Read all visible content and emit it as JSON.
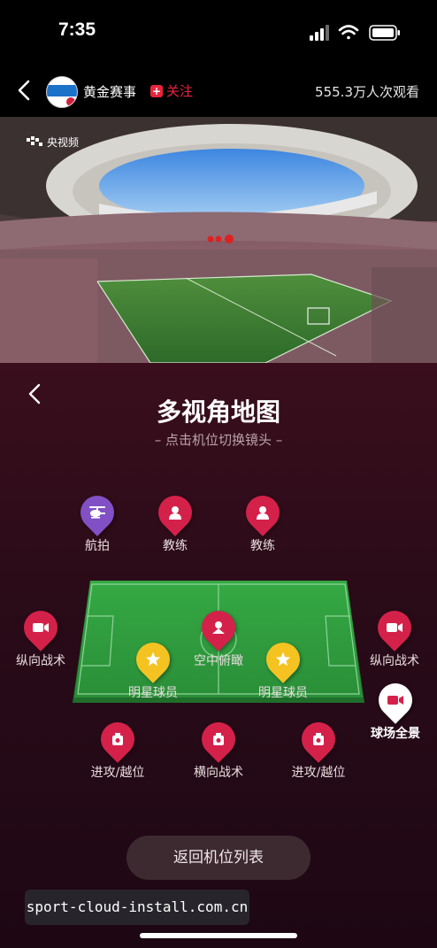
{
  "status_bar": {
    "time": "7:35"
  },
  "header": {
    "channel_name": "黄金赛事",
    "follow_label": "关注",
    "viewers": "555.3万人次观看"
  },
  "video": {
    "watermark": "央视频"
  },
  "panel": {
    "title": "多视角地图",
    "subtitle": "– 点击机位切换镜头 –",
    "cameras": [
      {
        "label": "航拍",
        "icon": "helicopter-icon"
      },
      {
        "label": "教练",
        "icon": "person-icon"
      },
      {
        "label": "教练",
        "icon": "person-icon"
      },
      {
        "label": "纵向战术",
        "icon": "video-camera-icon"
      },
      {
        "label": "空中俯瞰",
        "icon": "spider-cam-icon"
      },
      {
        "label": "纵向战术",
        "icon": "video-camera-icon"
      },
      {
        "label": "明星球员",
        "icon": "star-icon"
      },
      {
        "label": "明星球员",
        "icon": "star-icon"
      },
      {
        "label": "球场全景",
        "icon": "video-camera-icon"
      },
      {
        "label": "进攻/越位",
        "icon": "camera-icon"
      },
      {
        "label": "横向战术",
        "icon": "camera-icon"
      },
      {
        "label": "进攻/越位",
        "icon": "camera-icon"
      }
    ],
    "back_to_list": "返回机位列表"
  },
  "overlay": {
    "url": "sport-cloud-install.com.cn"
  },
  "colors": {
    "accent": "#d4214a",
    "aerial": "#8150c4",
    "star": "#f4c321",
    "pitch": "#2f9d3c"
  }
}
